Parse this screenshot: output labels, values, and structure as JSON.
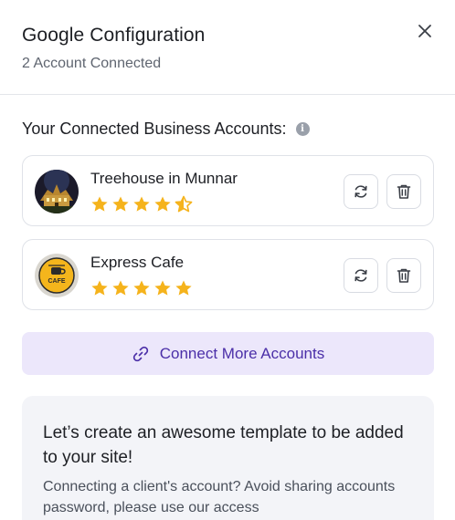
{
  "dialog": {
    "title": "Google Configuration",
    "subtitle": "2 Account Connected",
    "close_icon": "close-icon"
  },
  "accounts_section": {
    "title": "Your Connected Business Accounts:",
    "info_icon": "info-icon"
  },
  "accounts": [
    {
      "name": "Treehouse in Munnar",
      "rating": 4.5,
      "avatar": "hotel-photo"
    },
    {
      "name": "Express Cafe",
      "rating": 5,
      "avatar": "cafe-logo",
      "avatar_text": "CAFE"
    }
  ],
  "connect_button": {
    "label": "Connect More Accounts",
    "icon": "link-icon"
  },
  "info_panel": {
    "heading": "Let’s create an awesome template to be added to your site!",
    "text": "Connecting a client's account? Avoid sharing accounts password, please use our access"
  },
  "colors": {
    "star": "#f5b31c",
    "accent": "#4b2fa8",
    "accent_bg": "#ece7fb"
  }
}
